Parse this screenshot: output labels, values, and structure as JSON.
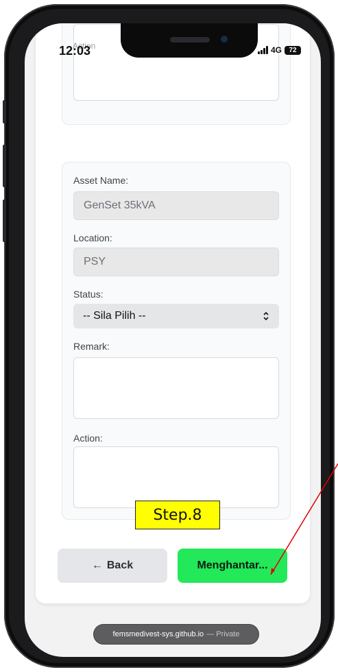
{
  "status_bar": {
    "time": "12:03",
    "network": "4G",
    "battery": "72"
  },
  "ghost_label": "Action",
  "form": {
    "asset_name_label": "Asset Name:",
    "asset_name_value": "GenSet 35kVA",
    "location_label": "Location:",
    "location_value": "PSY",
    "status_label": "Status:",
    "status_value": "-- Sila Pilih --",
    "remark_label": "Remark:",
    "action_label": "Action:"
  },
  "buttons": {
    "back": "Back",
    "back_arrow": "←",
    "submit": "Menghantar..."
  },
  "browser": {
    "domain": "femsmedivest-sys.github.io",
    "private": "— Private"
  },
  "annotation": {
    "step": "Step.8",
    "color": "#e00000"
  },
  "colors": {
    "submit_bg": "#22e85a",
    "step_bg": "#ffff00"
  }
}
